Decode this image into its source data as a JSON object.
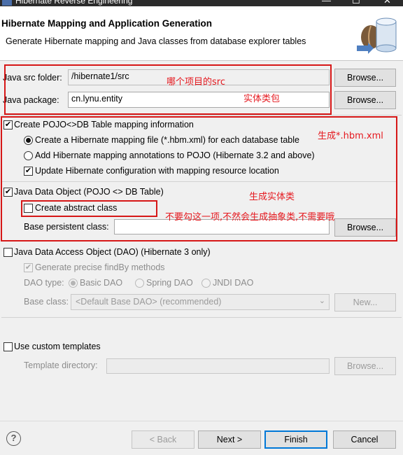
{
  "window": {
    "title": "Hibernate Reverse Engineering"
  },
  "header": {
    "title": "Hibernate Mapping and Application Generation",
    "description": "Generate Hibernate mapping and Java classes from database explorer tables"
  },
  "source": {
    "src_folder_label": "Java src folder:",
    "src_folder_value": "/hibernate1/src",
    "browse_label": "Browse...",
    "package_label": "Java package:",
    "package_value": "cn.lynu.entity"
  },
  "pojo_mapping": {
    "checkbox_label": "Create POJO<>DB Table mapping information",
    "checked": true,
    "option_file": "Create a Hibernate mapping file (*.hbm.xml) for each database table",
    "option_annotations": "Add Hibernate mapping annotations to POJO (Hibernate 3.2 and above)",
    "selected_option": "file",
    "update_config_label": "Update Hibernate configuration with mapping resource location",
    "update_config_checked": true
  },
  "java_data_object": {
    "checkbox_label": "Java Data Object (POJO <> DB Table)",
    "checked": true,
    "abstract_label": "Create abstract class",
    "abstract_checked": false,
    "base_class_label": "Base persistent class:",
    "base_class_value": "",
    "browse_label": "Browse..."
  },
  "dao": {
    "checkbox_label": "Java Data Access Object (DAO) (Hibernate 3 only)",
    "checked": false,
    "findby_label": "Generate precise findBy methods",
    "findby_checked": true,
    "type_label": "DAO type:",
    "types": [
      "Basic DAO",
      "Spring DAO",
      "JNDI DAO"
    ],
    "selected_type": "Basic DAO",
    "base_class_label": "Base class:",
    "base_class_value": "<Default Base DAO> (recommended)",
    "new_label": "New..."
  },
  "templates": {
    "checkbox_label": "Use custom templates",
    "checked": false,
    "directory_label": "Template directory:",
    "directory_value": "",
    "browse_label": "Browse..."
  },
  "footer": {
    "back_label": "< Back",
    "next_label": "Next >",
    "finish_label": "Finish",
    "cancel_label": "Cancel"
  },
  "annotations": {
    "src_note": "哪个项目的src",
    "package_note": "实体类包",
    "hbm_note": "生成*.hbm.xml",
    "entity_note": "生成实体类",
    "abstract_note": "不要勾这一项,不然会生成抽象类,不需要哦"
  },
  "colors": {
    "annotation": "#e5191f",
    "focus": "#0078d7"
  }
}
